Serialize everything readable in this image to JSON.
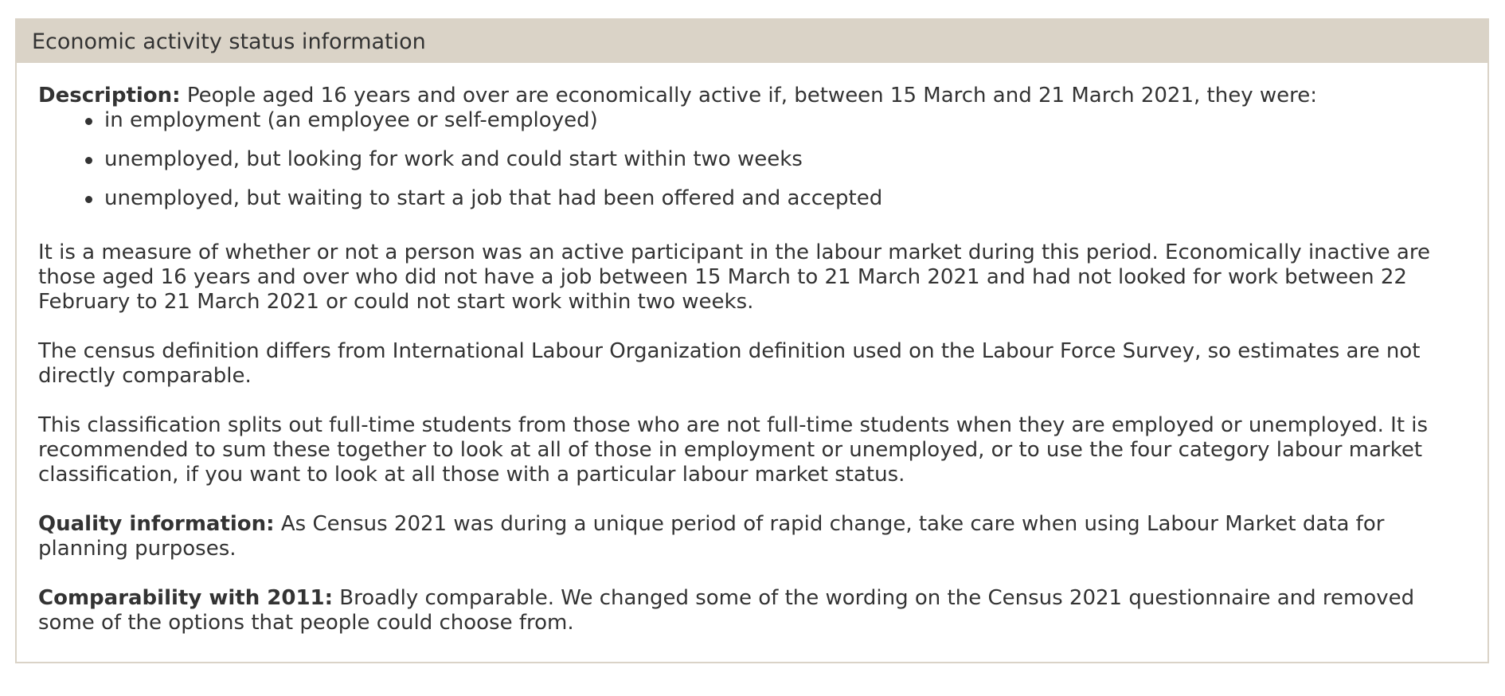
{
  "panel": {
    "title": "Economic activity status information"
  },
  "description": {
    "label": "Description:",
    "text": " People aged 16 years and over are economically active if, between 15 March and 21 March 2021, they were:",
    "bullets": [
      "in employment (an employee or self-employed)",
      "unemployed, but looking for work and could start within two weeks",
      "unemployed, but waiting to start a job that had been offered and accepted"
    ]
  },
  "paragraphs": [
    "It is a measure of whether or not a person was an active participant in the labour market during this period. Economically inactive are those aged 16 years and over who did not have a job between 15 March to 21 March 2021 and had not looked for work between 22 February to 21 March 2021 or could not start work within two weeks.",
    "The census definition differs from International Labour Organization definition used on the Labour Force Survey, so estimates are not directly comparable.",
    "This classification splits out full-time students from those who are not full-time students when they are employed or unemployed. It is recommended to sum these together to look at all of those in employment or unemployed, or to use the four category labour market classification, if you want to look at all those with a particular labour market status."
  ],
  "quality": {
    "label": "Quality information:",
    "text": " As Census 2021 was during a unique period of rapid change, take care when using Labour Market data for planning purposes."
  },
  "comparability": {
    "label": "Comparability with 2011:",
    "text": " Broadly comparable. We changed some of the wording on the Census 2021 questionnaire and removed some of the options that people could choose from."
  },
  "colors": {
    "header_bg": "#dad3c7",
    "text": "#333333"
  }
}
